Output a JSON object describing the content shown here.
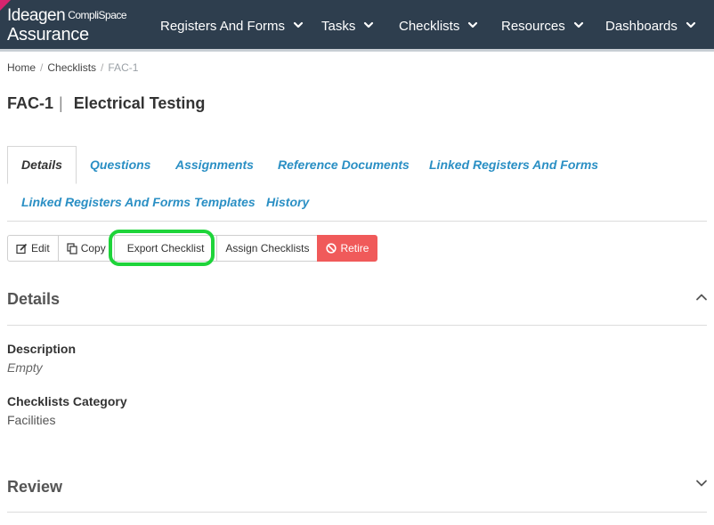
{
  "brand": {
    "line1": "Ideagen",
    "line1_sub": "CompliSpace",
    "line2": "Assurance"
  },
  "nav": [
    {
      "label": "Registers And Forms"
    },
    {
      "label": "Tasks"
    },
    {
      "label": "Checklists"
    },
    {
      "label": "Resources"
    },
    {
      "label": "Dashboards"
    }
  ],
  "breadcrumb": {
    "home": "Home",
    "section": "Checklists",
    "current": "FAC-1",
    "separator": "/"
  },
  "title": {
    "code": "FAC-1",
    "divider": "|",
    "name": "Electrical Testing"
  },
  "tabs": [
    {
      "label": "Details",
      "active": true
    },
    {
      "label": "Questions"
    },
    {
      "label": "Assignments"
    },
    {
      "label": "Reference Documents"
    },
    {
      "label": "Linked Registers And Forms"
    },
    {
      "label": "Linked Registers And Forms Templates"
    },
    {
      "label": "History"
    }
  ],
  "actions": {
    "edit": "Edit",
    "copy": "Copy",
    "export": "Export Checklist",
    "assign": "Assign Checklists",
    "retire": "Retire"
  },
  "details": {
    "heading": "Details",
    "description_label": "Description",
    "description_value": "Empty",
    "category_label": "Checklists Category",
    "category_value": "Facilities"
  },
  "review": {
    "heading": "Review"
  },
  "colors": {
    "topbar": "#2e3e4e",
    "link": "#2a8fc4",
    "retire": "#f05a5a",
    "highlight": "#1ed43a",
    "brand_accent": "#d6246e"
  }
}
